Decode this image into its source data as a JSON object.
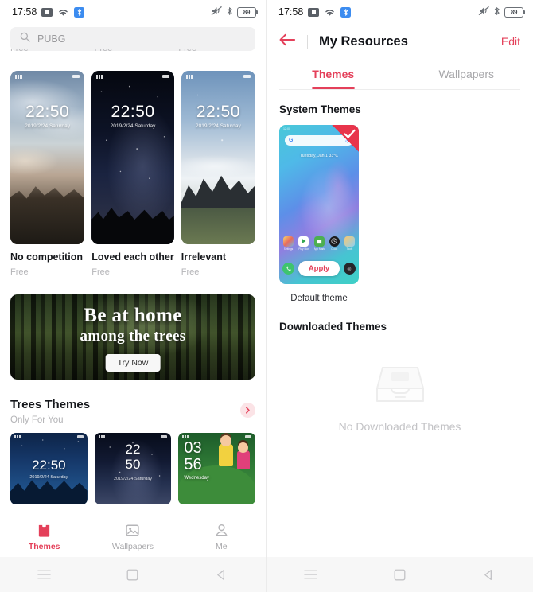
{
  "status_bar": {
    "time": "17:58",
    "battery": "89",
    "icons": [
      "screenshot-icon",
      "wifi-icon",
      "bluetooth-badge-icon",
      "mute-icon",
      "bluetooth-icon",
      "battery-icon"
    ]
  },
  "left_panel": {
    "search": {
      "value": "PUBG",
      "placeholder": "Search"
    },
    "clipped_row_prices": [
      "Free",
      "Free",
      "Free"
    ],
    "theme_cards": [
      {
        "name": "No competition",
        "price": "Free",
        "clock": "22:50",
        "date": "2019/2/24 Saturday"
      },
      {
        "name": "Loved each other",
        "price": "Free",
        "clock": "22:50",
        "date": "2019/2/24 Saturday"
      },
      {
        "name": "Irrelevant",
        "price": "Free",
        "clock": "22:50",
        "date": "2019/2/24 Saturday"
      }
    ],
    "banner": {
      "line1": "Be at home",
      "line2": "among the trees",
      "button": "Try Now"
    },
    "section": {
      "title": "Trees Themes",
      "subtitle": "Only For You",
      "arrow": "chevron-right-icon"
    },
    "small_cards": [
      {
        "clock": "22:50",
        "date": "2019/2/24 Saturday"
      },
      {
        "clock_line1": "22",
        "clock_line2": "50",
        "date": "2019/2/24 Saturday"
      },
      {
        "clock_line1": "03",
        "clock_line2": "56",
        "date": "Wednesday"
      }
    ],
    "bottom_nav": [
      {
        "label": "Themes",
        "icon": "themes-icon",
        "active": true
      },
      {
        "label": "Wallpapers",
        "icon": "image-icon",
        "active": false
      },
      {
        "label": "Me",
        "icon": "person-icon",
        "active": false
      }
    ]
  },
  "right_panel": {
    "header": {
      "back": "back-arrow-icon",
      "title": "My Resources",
      "edit": "Edit"
    },
    "tabs": [
      {
        "label": "Themes",
        "active": true
      },
      {
        "label": "Wallpapers",
        "active": false
      }
    ],
    "system_themes": {
      "title": "System Themes",
      "theme": {
        "name": "Default theme",
        "apply": "Apply",
        "selected": true,
        "widget": "Tuesday, Jan 1   33°C",
        "dock": [
          "Settings",
          "Play Store",
          "App Market",
          "Clock",
          "Tools"
        ]
      }
    },
    "downloaded_themes": {
      "title": "Downloaded Themes",
      "empty": "No Downloaded Themes"
    }
  },
  "system_nav": [
    "menu-button",
    "home-button",
    "back-button"
  ],
  "colors": {
    "accent": "#e4405a",
    "muted": "#b3b3b6",
    "bg": "#ffffff"
  }
}
